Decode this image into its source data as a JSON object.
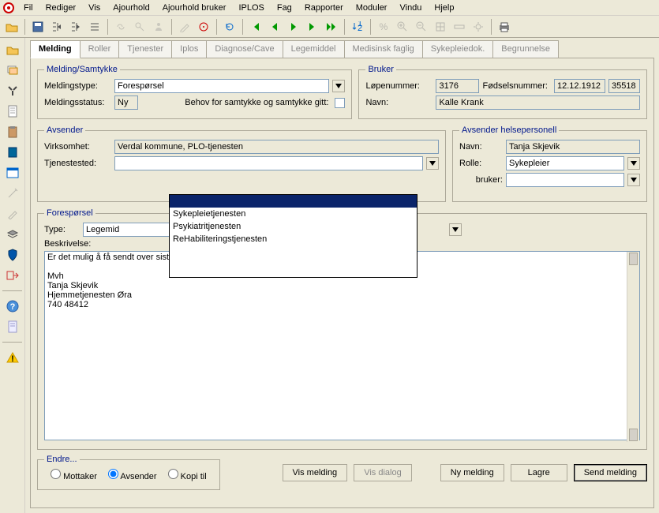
{
  "menu": [
    "Fil",
    "Rediger",
    "Vis",
    "Ajourhold",
    "Ajourhold bruker",
    "IPLOS",
    "Fag",
    "Rapporter",
    "Moduler",
    "Vindu",
    "Hjelp"
  ],
  "tabs": [
    "Melding",
    "Roller",
    "Tjenester",
    "Iplos",
    "Diagnose/Cave",
    "Legemiddel",
    "Medisinsk faglig",
    "Sykepleiedok.",
    "Begrunnelse"
  ],
  "melding": {
    "legend": "Melding/Samtykke",
    "type_lbl": "Meldingstype:",
    "type_val": "Forespørsel",
    "status_lbl": "Meldingsstatus:",
    "status_val": "Ny",
    "samtykke_lbl": "Behov for samtykke og samtykke gitt:"
  },
  "bruker": {
    "legend": "Bruker",
    "lope_lbl": "Løpenummer:",
    "lope_val": "3176",
    "fnr_lbl": "Fødselsnummer:",
    "fnr_a": "12.12.1912",
    "fnr_b": "35518",
    "navn_lbl": "Navn:",
    "navn_val": "Kalle Krank"
  },
  "avsender": {
    "legend": "Avsender",
    "virk_lbl": "Virksomhet:",
    "virk_val": "Verdal kommune, PLO-tjenesten",
    "tjen_lbl": "Tjenestested:",
    "tjen_val": ""
  },
  "helsepers": {
    "legend": "Avsender helsepersonell",
    "navn_lbl": "Navn:",
    "navn_val": "Tanja Skjevik",
    "rolle_lbl": "Rolle:",
    "rolle_val": "Sykepleier",
    "bruker_lbl": "bruker:",
    "bruker_val": ""
  },
  "dropdown_options": [
    "",
    "Sykepleietjenesten",
    "Psykiatritjenesten",
    "ReHabiliteringstjenesten"
  ],
  "foresporsel": {
    "legend": "Forespørsel",
    "type_lbl": "Type:",
    "type_val": "Legemid",
    "besk_lbl": "Beskrivelse:",
    "besk_val": "Er det mulig å få sendt over siste Marevan dosering og dato for neste prøve?\n\nMvh\nTanja Skjevik\nHjemmetjenesten Øra\n740 48412"
  },
  "endre": {
    "legend": "Endre...",
    "opts": [
      "Mottaker",
      "Avsender",
      "Kopi til"
    ],
    "selected": 1
  },
  "buttons": {
    "vis_melding": "Vis melding",
    "vis_dialog": "Vis dialog",
    "ny_melding": "Ny melding",
    "lagre": "Lagre",
    "send": "Send melding"
  }
}
